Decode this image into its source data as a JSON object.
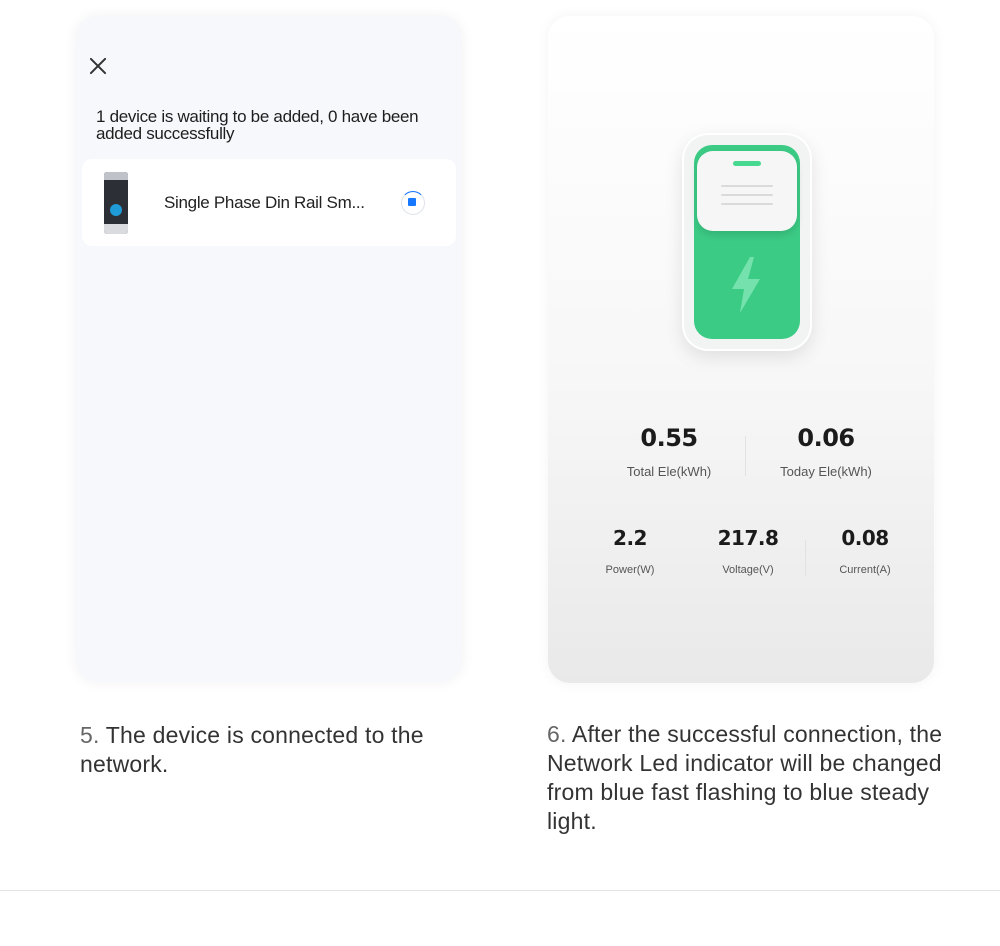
{
  "left_screen": {
    "close_label": "×",
    "waiting_text": "1 device is waiting to be added, 0 have been added successfully",
    "device_name": "Single Phase Din Rail Sm..."
  },
  "right_screen": {
    "total_ele": {
      "value": "0.55",
      "label": "Total Ele(kWh)"
    },
    "today_ele": {
      "value": "0.06",
      "label": "Today Ele(kWh)"
    },
    "power": {
      "value": "2.2",
      "label": "Power(W)"
    },
    "voltage": {
      "value": "217.8",
      "label": "Voltage(V)"
    },
    "current": {
      "value": "0.08",
      "label": "Current(A)"
    },
    "switch_color": "#3ccb85"
  },
  "captions": {
    "step5_number": "5.",
    "step5_text": "The device is connected to the network.",
    "step6_number": "6.",
    "step6_text": "After the successful connection, the Network Led indicator will be changed from blue fast flashing to blue steady light."
  },
  "icons": {
    "close": "close-icon",
    "loading": "loading-spinner-icon",
    "bolt": "lightning-bolt-icon"
  }
}
